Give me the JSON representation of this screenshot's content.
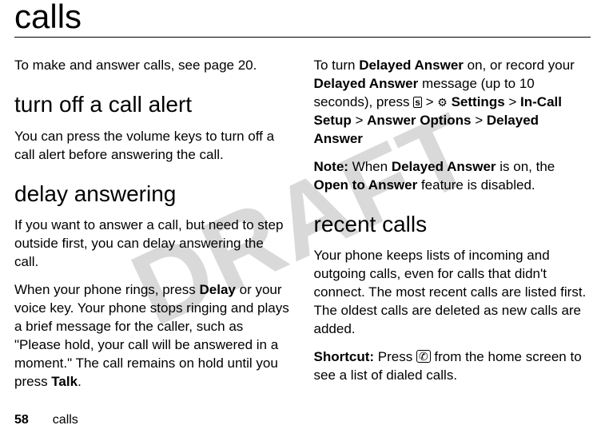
{
  "watermark": "DRAFT",
  "title": "calls",
  "col1": {
    "intro": "To make and answer calls, see page 20.",
    "h1": "turn off a call alert",
    "p1": "You can press the volume keys to turn off a call alert before answering the call.",
    "h2": "delay answering",
    "p2": "If you want to answer a call, but need to step outside first, you can delay answering the call.",
    "p3a": "When your phone rings, press ",
    "p3_b1": "Delay",
    "p3b": " or your voice key. Your phone stops ringing and plays a brief message for the caller, such as \"Please hold, your call will be answered in a moment.\" The call remains on hold until you press ",
    "p3_b2": "Talk",
    "p3c": "."
  },
  "col2": {
    "p1a": "To turn ",
    "p1_b1": "Delayed Answer",
    "p1b": " on, or record your ",
    "p1_b2": "Delayed Answer",
    "p1c": " message (up to 10 seconds), press ",
    "p1d": " > ",
    "p1_b3": "Settings",
    "p1e": " > ",
    "p1_b4": "In-Call Setup",
    "p1f": " > ",
    "p1_b5": "Answer Options",
    "p1g": " > ",
    "p1_b6": "Delayed Answer",
    "note_label": "Note:",
    "note_a": " When ",
    "note_b1": "Delayed Answer",
    "note_b": " is on, the ",
    "note_b2": "Open to Answer",
    "note_c": " feature is disabled.",
    "h1": "recent calls",
    "p2": "Your phone keeps lists of incoming and outgoing calls, even for calls that didn't connect. The most recent calls are listed first. The oldest calls are deleted as new calls are added.",
    "sc_label": "Shortcut:",
    "sc_a": " Press ",
    "sc_b": " from the home screen to see a list of dialed calls."
  },
  "glyphs": {
    "menu": "s",
    "settings": "⚙",
    "send": "✆"
  },
  "footer": {
    "page": "58",
    "section": "calls"
  }
}
